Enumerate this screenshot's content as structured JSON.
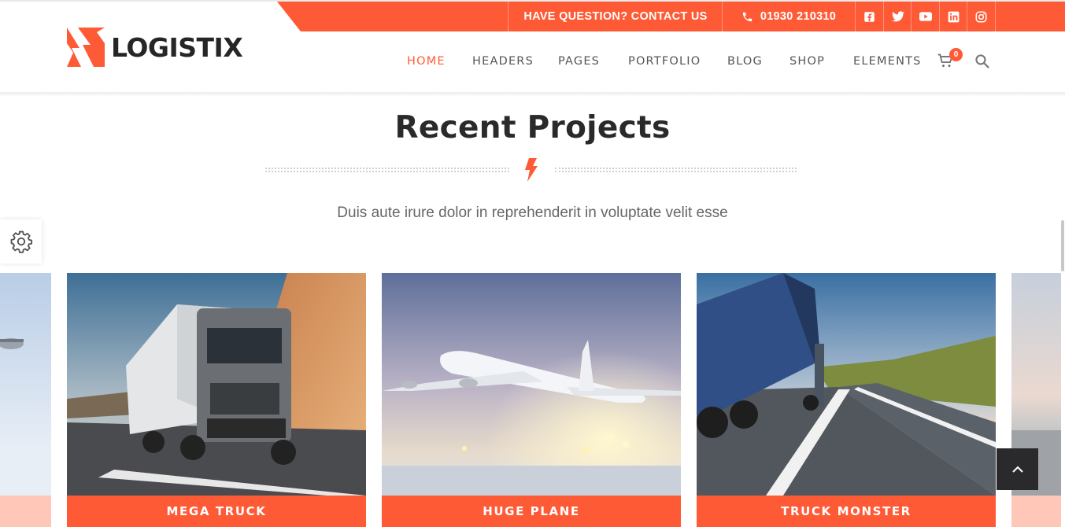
{
  "topbar": {
    "contact": "HAVE QUESTION? CONTACT US",
    "phone": "01930 210310",
    "social": [
      "facebook-icon",
      "twitter-icon",
      "youtube-icon",
      "linkedin-icon",
      "instagram-icon"
    ]
  },
  "brand": {
    "name": "LOGISTIX"
  },
  "nav": {
    "items": [
      "HOME",
      "HEADERS",
      "PAGES",
      "PORTFOLIO",
      "BLOG",
      "SHOP",
      "ELEMENTS"
    ],
    "active": "HOME",
    "cart_count": "0"
  },
  "section": {
    "title": "Recent Projects",
    "subtitle": "Duis aute irure dolor in reprehenderit in voluptate velit esse"
  },
  "projects": [
    {
      "title": "MEGA TRUCK"
    },
    {
      "title": "HUGE PLANE"
    },
    {
      "title": "TRUCK MONSTER"
    }
  ],
  "colors": {
    "accent": "#ff5a36",
    "text": "#2a2a2a",
    "muted": "#666666"
  }
}
